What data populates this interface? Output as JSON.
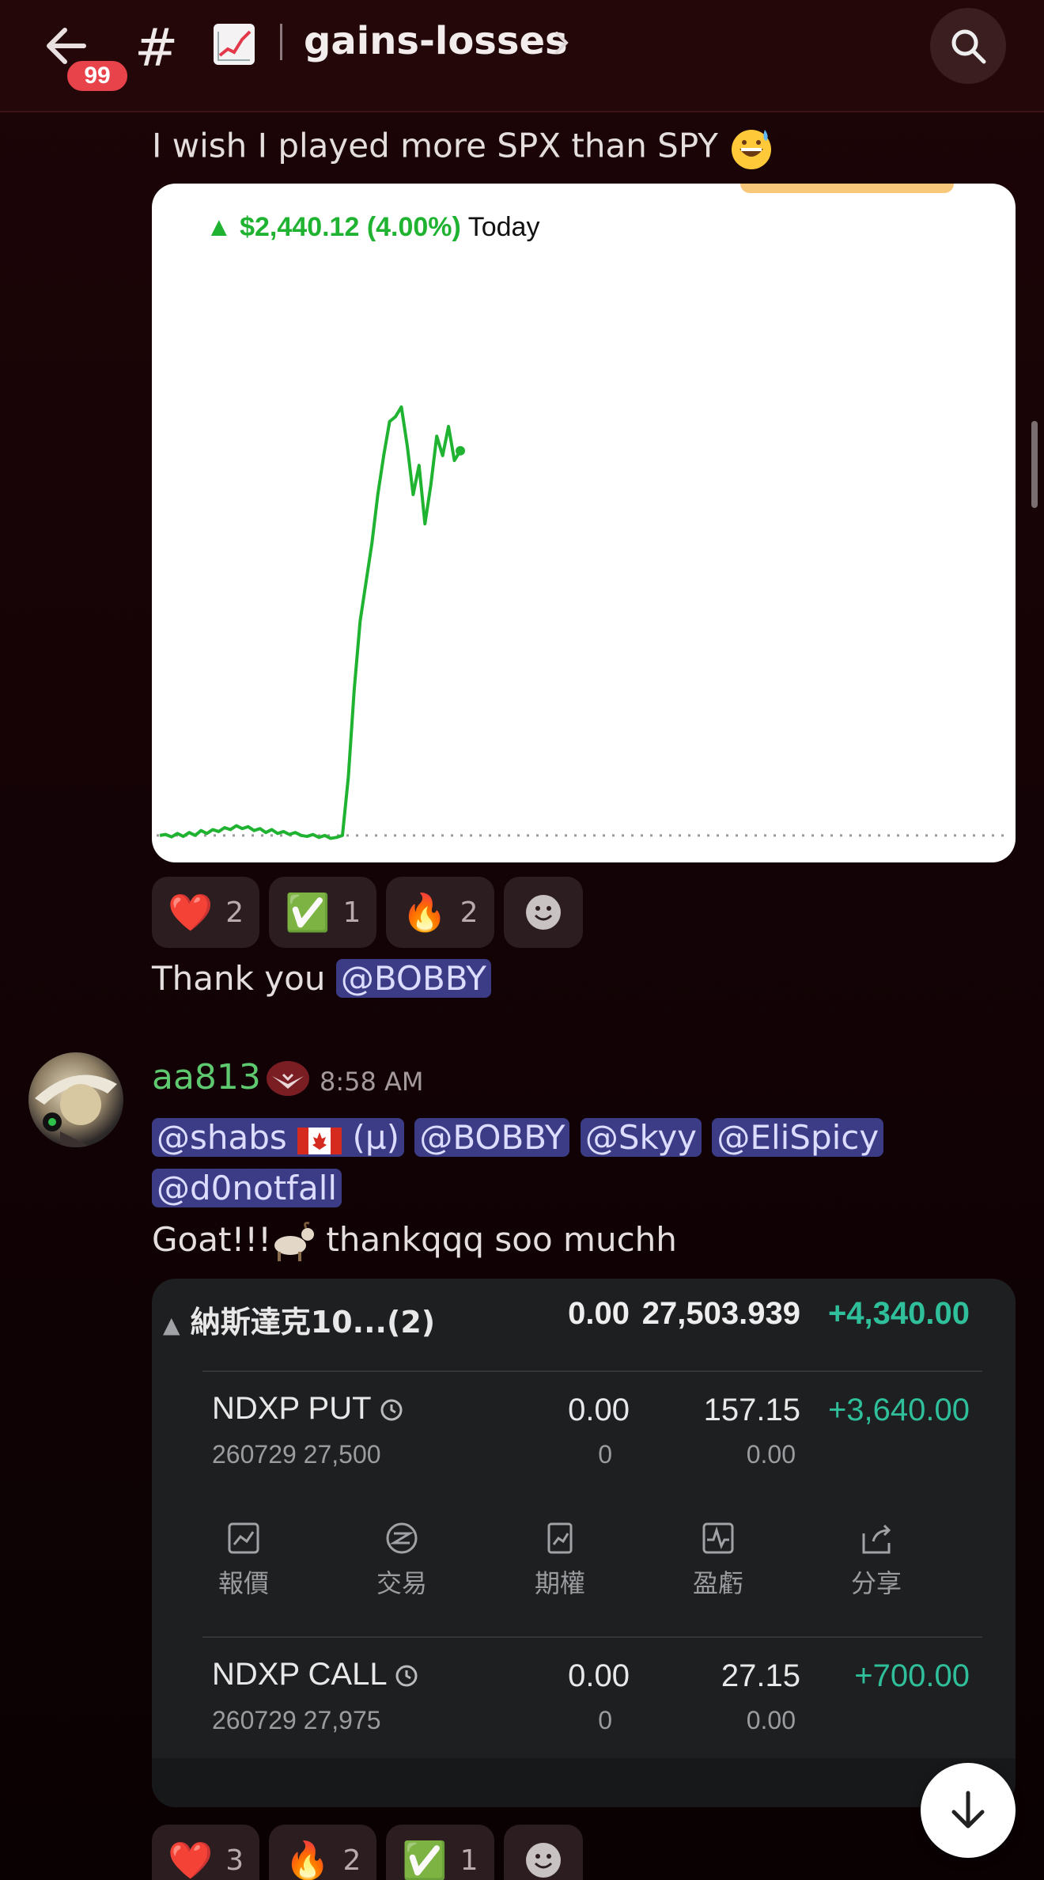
{
  "header": {
    "unread_badge": "99",
    "hash": "#",
    "channel_name": "gains-losses",
    "icons": [
      "arrow-left-icon",
      "chart-up-emoji-icon",
      "chevron-right-icon",
      "search-icon"
    ]
  },
  "message1": {
    "text": "I wish I played more SPX than SPY",
    "emoji": "grinning-sweat-emoji"
  },
  "chart_card": {
    "change": "$2,440.12 (4.00%)",
    "period": "Today",
    "accent_color": "#1fb331"
  },
  "chart_data": {
    "type": "line",
    "title": "",
    "xlabel": "",
    "ylabel": "",
    "baseline": 0,
    "series": [
      {
        "values": [
          0,
          2,
          -3,
          4,
          -2,
          6,
          0,
          10,
          4,
          12,
          8,
          16,
          12,
          20,
          14,
          18,
          10,
          14,
          6,
          12,
          4,
          8,
          2,
          6,
          0,
          -2,
          2,
          -4,
          0,
          -6,
          -4,
          0,
          120,
          300,
          440,
          520,
          600,
          700,
          780,
          850,
          860,
          880,
          800,
          700,
          760,
          640,
          720,
          820,
          780,
          840,
          770,
          790
        ]
      }
    ]
  },
  "reactions1": [
    {
      "icon": "heart-emoji",
      "glyph": "❤️",
      "count": "2"
    },
    {
      "icon": "check-mark-emoji",
      "glyph": "✅",
      "count": "1"
    },
    {
      "icon": "fire-emoji",
      "glyph": "🔥",
      "count": "2"
    }
  ],
  "message2": {
    "text": "Thank you",
    "mention": "@BOBBY"
  },
  "message3": {
    "author": "aa813",
    "time": "8:58 AM",
    "mentions": [
      "@shabs",
      "(µ)",
      "@BOBBY",
      "@Skyy",
      "@EliSpicy",
      "@d0notfall"
    ],
    "text_prefix": "Goat!!!",
    "text_suffix": " thankqqq soo muchh"
  },
  "broker": {
    "summary": {
      "name": "納斯達克10...(2)",
      "qty": "0.00",
      "price": "27,503.939",
      "pl": "+4,340.00"
    },
    "positions": [
      {
        "name": "NDXP PUT",
        "detail": "260729 27,500",
        "qty": "0.00",
        "qty_sub": "0",
        "price": "157.15",
        "price_sub": "0.00",
        "pl": "+3,640.00"
      },
      {
        "name": "NDXP CALL",
        "detail": "260729 27,975",
        "qty": "0.00",
        "qty_sub": "0",
        "price": "27.15",
        "price_sub": "0.00",
        "pl": "+700.00"
      }
    ],
    "actions": [
      {
        "icon": "quote-chart-icon",
        "label": "報價"
      },
      {
        "icon": "trade-icon",
        "label": "交易"
      },
      {
        "icon": "options-icon",
        "label": "期權"
      },
      {
        "icon": "pnl-icon",
        "label": "盈虧"
      },
      {
        "icon": "share-icon",
        "label": "分享"
      }
    ],
    "pl_color": "#2fbf9a"
  },
  "reactions2": [
    {
      "icon": "heart-emoji",
      "glyph": "❤️",
      "count": "3"
    },
    {
      "icon": "fire-emoji",
      "glyph": "🔥",
      "count": "2"
    },
    {
      "icon": "check-mark-emoji",
      "glyph": "✅",
      "count": "1"
    }
  ]
}
